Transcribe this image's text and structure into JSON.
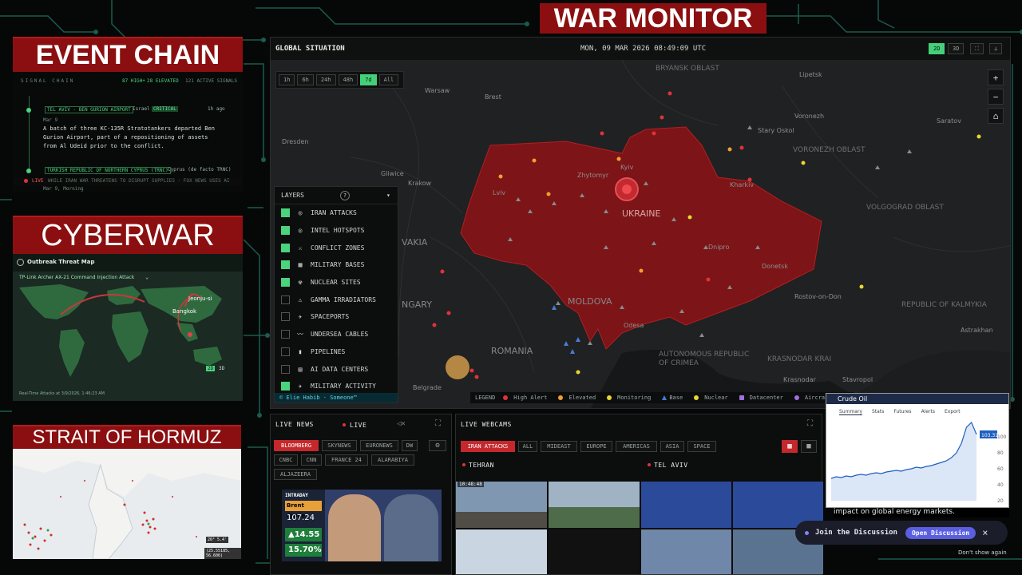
{
  "titles": {
    "war_monitor": "WAR MONITOR",
    "event_chain": "EVENT CHAIN",
    "cyberwar": "CYBERWAR",
    "strait": "STRAIT OF HORMUZ"
  },
  "event_chain": {
    "signal_chain": "SIGNAL CHAIN",
    "stat1": "87 HIGH+",
    "stat2": "28 ELEVATED",
    "stat3": "121 ACTIVE SIGNALS",
    "ev1_loc": "TEL AVIV - BEN GURION AIRPORT",
    "ev1_src": "Israel",
    "ev1_badge": "CRITICAL",
    "ev1_ago": "1h ago",
    "ev1_date": "Mar 9",
    "ev1_text1": "A batch of three KC-135R Stratotankers departed Ben",
    "ev1_text2": "Gurion Airport, part of a repositioning of assets",
    "ev1_text3": "from Al Udeid prior to the conflict.",
    "ev2_loc": "TURKISH REPUBLIC OF NORTHERN CYPRUS (TRNC)",
    "ev2_src": "Cyprus (de facto TRNC)",
    "ticker_live": "LIVE",
    "ticker_text": "WHILE IRAN WAR THREATENS TO DISRUPT SUPPLIES · FOX NEWS USES AI",
    "ev2_date": "Mar 9, Morning"
  },
  "cyber": {
    "map_title": "Outbreak Threat Map",
    "attack": "TP-Link Archer AX-21 Command Injection Attack",
    "place1": "Jeonju-si",
    "place2": "Bangkok",
    "footer": "Real-Time Attacks at 3/9/2026, 1:46:23 AM",
    "view2d": "2D",
    "view3d": "3D"
  },
  "hormuz": {
    "coords1": "26° 5.4'",
    "coords2": "(25.55185, 56.606)"
  },
  "map": {
    "label": "GLOBAL SITUATION",
    "datetime": "MON, 09 MAR 2026 08:49:09 UTC",
    "view_2d": "2D",
    "view_3d": "3D",
    "ranges": [
      "1h",
      "6h",
      "24h",
      "48h",
      "7d",
      "All"
    ],
    "active_range": 4,
    "zoom_in": "+",
    "zoom_out": "−",
    "home": "⌂",
    "layers_title": "LAYERS",
    "layers_help": "?",
    "layers": [
      {
        "label": "IRAN ATTACKS",
        "on": true,
        "icon": "target-icon",
        "glyph": "◎"
      },
      {
        "label": "INTEL HOTSPOTS",
        "on": true,
        "icon": "target-icon",
        "glyph": "◎"
      },
      {
        "label": "CONFLICT ZONES",
        "on": true,
        "icon": "crossed-swords-icon",
        "glyph": "⚔"
      },
      {
        "label": "MILITARY BASES",
        "on": true,
        "icon": "building-icon",
        "glyph": "▦"
      },
      {
        "label": "NUCLEAR SITES",
        "on": true,
        "icon": "radiation-icon",
        "glyph": "☢"
      },
      {
        "label": "GAMMA IRRADIATORS",
        "on": false,
        "icon": "hazard-icon",
        "glyph": "⚠"
      },
      {
        "label": "SPACEPORTS",
        "on": false,
        "icon": "rocket-icon",
        "glyph": "✈"
      },
      {
        "label": "UNDERSEA CABLES",
        "on": false,
        "icon": "cable-icon",
        "glyph": "〰"
      },
      {
        "label": "PIPELINES",
        "on": false,
        "icon": "pipeline-icon",
        "glyph": "▮"
      },
      {
        "label": "AI DATA CENTERS",
        "on": false,
        "icon": "server-icon",
        "glyph": "▤"
      },
      {
        "label": "MILITARY ACTIVITY",
        "on": true,
        "icon": "jet-icon",
        "glyph": "✈"
      }
    ],
    "credit": "© Elie Habib · Someone™",
    "legend_title": "LEGEND",
    "legend": [
      {
        "label": "High Alert",
        "color": "#e0323b",
        "shape": "dot"
      },
      {
        "label": "Elevated",
        "color": "#f0a030",
        "shape": "dot"
      },
      {
        "label": "Monitoring",
        "color": "#e6d830",
        "shape": "dot"
      },
      {
        "label": "Base",
        "color": "#4a7bd8",
        "shape": "tri"
      },
      {
        "label": "Nuclear",
        "color": "#e6d830",
        "shape": "dot"
      },
      {
        "label": "Datacenter",
        "color": "#a070e0",
        "shape": "sq"
      },
      {
        "label": "Aircraft",
        "color": "#a070e0",
        "shape": "dot"
      }
    ],
    "places": {
      "warsaw": "Warsaw",
      "brest": "Brest",
      "dresden": "Dresden",
      "gliwice": "Gliwice",
      "krakow": "Krakow",
      "lviv": "Lviv",
      "zhytomyr": "Zhytomyr",
      "kyiv": "Kyiv",
      "kharkiv": "Kharkiv",
      "dnipro": "Dnipro",
      "donetsk": "Donetsk",
      "odesa": "Odesa",
      "belgrade": "Belgrade",
      "lipetsk": "Lipetsk",
      "voronezh": "Voronezh",
      "saratov": "Saratov",
      "stary_oskol": "Stary Oskol",
      "rostov": "Rostov-on-Don",
      "astrakhan": "Astrakhan",
      "krasnodar": "Krasnodar",
      "stavropol": "Stavropol"
    },
    "regions": {
      "ukraine": "UKRAINE",
      "moldova": "MOLDOVA",
      "romania": "ROMANIA",
      "vakia": "VAKIA",
      "ngary": "NGARY",
      "bryansk": "BRYANSK OBLAST",
      "voronezh_obl": "VORONEZH OBLAST",
      "volgograd": "VOLGOGRAD OBLAST",
      "kalmykia": "REPUBLIC OF KALMYKIA",
      "crimea": "AUTONOMOUS REPUBLIC OF CRIMEA",
      "krasnodar_krai": "KRASNODAR KRAI"
    }
  },
  "news": {
    "title": "LIVE NEWS",
    "live": "LIVE",
    "channels": [
      "BLOOMBERG",
      "SKYNEWS",
      "EURONEWS",
      "DW",
      "CNBC",
      "CNN",
      "FRANCE 24",
      "ALARABIYA",
      "ALJAZEERA"
    ],
    "active": 0,
    "ticker_label": "INTRADAY",
    "ticker_name": "Brent Crude",
    "ticker_price": "107.24",
    "ticker_change": "▲14.55",
    "ticker_pct": "15.70%"
  },
  "webcams": {
    "title": "LIVE WEBCAMS",
    "filters": [
      "IRAN ATTACKS",
      "ALL",
      "MIDEAST",
      "EUROPE",
      "AMERICAS",
      "ASIA",
      "SPACE"
    ],
    "active": 0,
    "cam1": "TEHRAN",
    "cam2": "TEL AVIV",
    "cam_time": "10:48:48"
  },
  "crude": {
    "title": "Crude Oil",
    "tabs": [
      "Summary",
      "Stats",
      "Futures",
      "Alerts",
      "Export"
    ],
    "price_tag": "103.31",
    "y_ticks": [
      "100",
      "80",
      "60",
      "40",
      "20"
    ],
    "series_values": [
      48,
      50,
      49,
      51,
      50,
      52,
      53,
      52,
      54,
      55,
      54,
      56,
      57,
      58,
      57,
      59,
      60,
      62,
      61,
      63,
      64,
      66,
      68,
      70,
      74,
      80,
      92,
      112,
      118,
      103
    ],
    "y_range": [
      20,
      120
    ],
    "caption": "impact on global energy markets."
  },
  "discussion": {
    "label": "Join the Discussion",
    "button": "Open Discussion",
    "close": "×",
    "dismiss": "Don't show again"
  }
}
